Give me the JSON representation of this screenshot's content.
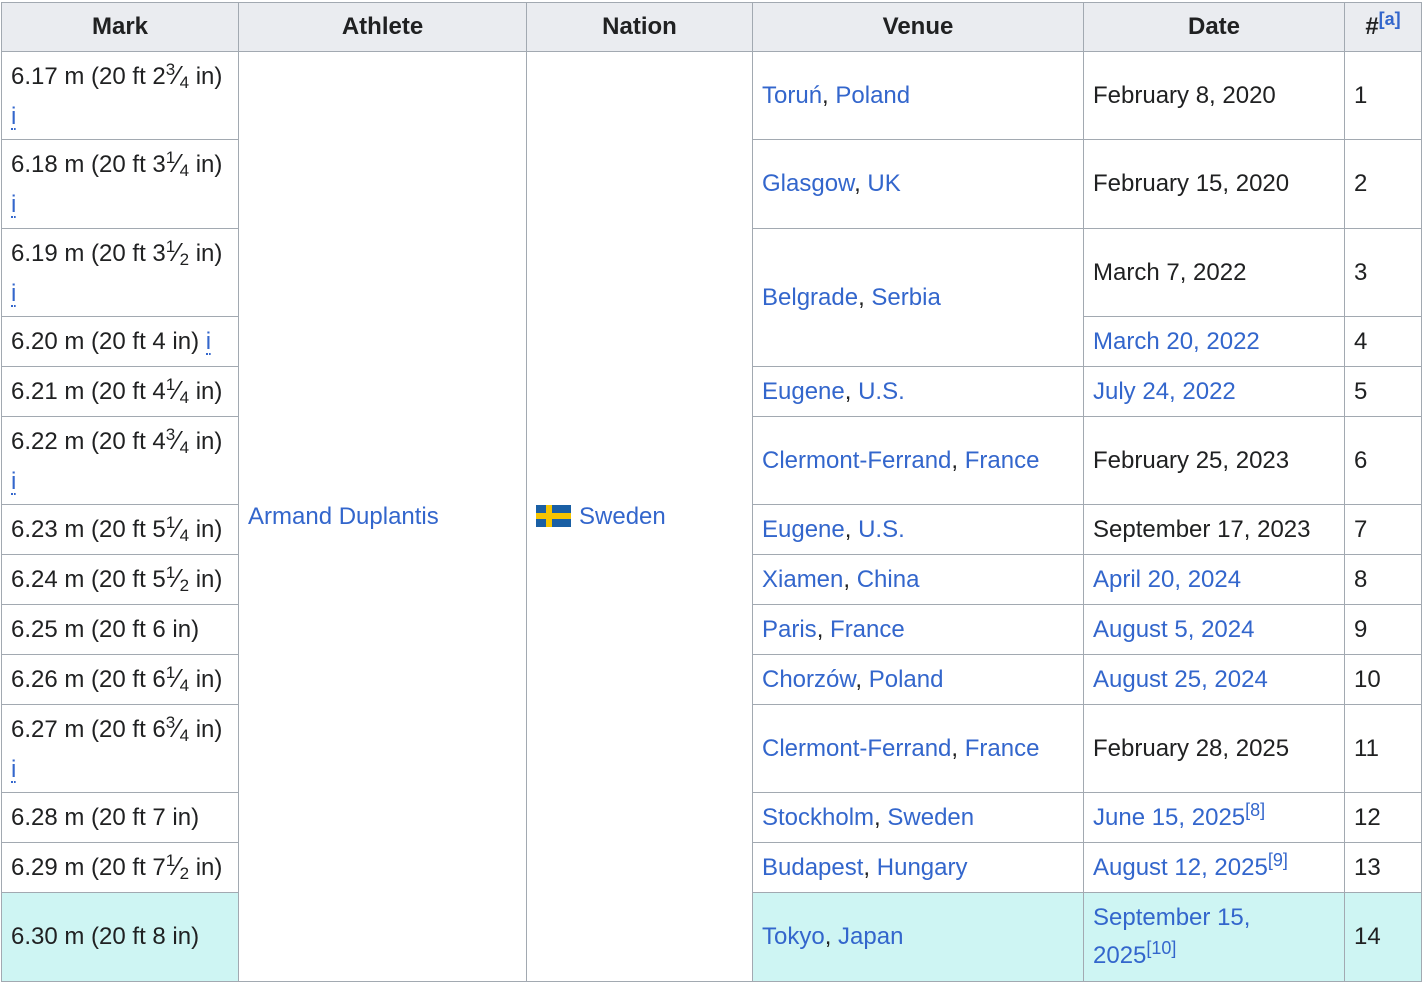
{
  "headers": {
    "mark": "Mark",
    "athlete": "Athlete",
    "nation": "Nation",
    "venue": "Venue",
    "date": "Date",
    "num": "#",
    "num_ref": "[a]"
  },
  "athlete": "Armand Duplantis",
  "nation": "Sweden",
  "info_link": "i",
  "rows": [
    {
      "mark_main": "6.17 m (20 ft 2",
      "frac_n": "3",
      "frac_d": "4",
      "mark_tail": " in)",
      "info": true,
      "city": "Toruń",
      "country": "Poland",
      "date": "February 8, 2020",
      "date_link": false,
      "date_ref": "",
      "num": "1"
    },
    {
      "mark_main": "6.18 m (20 ft 3",
      "frac_n": "1",
      "frac_d": "4",
      "mark_tail": " in)",
      "info": true,
      "city": "Glasgow",
      "country": "UK",
      "date": "February 15, 2020",
      "date_link": false,
      "date_ref": "",
      "num": "2"
    },
    {
      "mark_main": "6.19 m (20 ft 3",
      "frac_n": "1",
      "frac_d": "2",
      "mark_tail": " in)",
      "info": true,
      "city": "Belgrade",
      "country": "Serbia",
      "date": "March 7, 2022",
      "date_link": false,
      "date_ref": "",
      "num": "3"
    },
    {
      "mark_main": "6.20 m (20 ft 4 in) ",
      "frac_n": "",
      "frac_d": "",
      "mark_tail": "",
      "info": true,
      "city": "",
      "country": "",
      "date": "March 20, 2022",
      "date_link": true,
      "date_ref": "",
      "num": "4"
    },
    {
      "mark_main": "6.21 m (20 ft 4",
      "frac_n": "1",
      "frac_d": "4",
      "mark_tail": " in)",
      "info": false,
      "city": "Eugene",
      "country": "U.S.",
      "date": "July 24, 2022",
      "date_link": true,
      "date_ref": "",
      "num": "5"
    },
    {
      "mark_main": "6.22 m (20 ft 4",
      "frac_n": "3",
      "frac_d": "4",
      "mark_tail": " in)",
      "info": true,
      "city": "Clermont-Ferrand",
      "country": "France",
      "date": "February 25, 2023",
      "date_link": false,
      "date_ref": "",
      "num": "6"
    },
    {
      "mark_main": "6.23 m (20 ft 5",
      "frac_n": "1",
      "frac_d": "4",
      "mark_tail": " in)",
      "info": false,
      "city": "Eugene",
      "country": "U.S.",
      "date": "September 17, 2023",
      "date_link": false,
      "date_ref": "",
      "num": "7"
    },
    {
      "mark_main": "6.24 m (20 ft 5",
      "frac_n": "1",
      "frac_d": "2",
      "mark_tail": " in)",
      "info": false,
      "city": "Xiamen",
      "country": "China",
      "date": "April 20, 2024",
      "date_link": true,
      "date_ref": "",
      "num": "8"
    },
    {
      "mark_main": "6.25 m (20 ft 6 in)",
      "frac_n": "",
      "frac_d": "",
      "mark_tail": "",
      "info": false,
      "city": "Paris",
      "country": "France",
      "date": "August 5, 2024",
      "date_link": true,
      "date_ref": "",
      "num": "9"
    },
    {
      "mark_main": "6.26 m (20 ft 6",
      "frac_n": "1",
      "frac_d": "4",
      "mark_tail": " in)",
      "info": false,
      "city": "Chorzów",
      "country": "Poland",
      "date": "August 25, 2024",
      "date_link": true,
      "date_ref": "",
      "num": "10"
    },
    {
      "mark_main": "6.27 m (20 ft 6",
      "frac_n": "3",
      "frac_d": "4",
      "mark_tail": " in)",
      "info": true,
      "city": "Clermont-Ferrand",
      "country": "France",
      "date": "February 28, 2025",
      "date_link": false,
      "date_ref": "",
      "num": "11"
    },
    {
      "mark_main": "6.28 m (20 ft 7 in)",
      "frac_n": "",
      "frac_d": "",
      "mark_tail": "",
      "info": false,
      "city": "Stockholm",
      "country": "Sweden",
      "date": "June 15, 2025",
      "date_link": true,
      "date_ref": "[8]",
      "num": "12"
    },
    {
      "mark_main": "6.29 m (20 ft 7",
      "frac_n": "1",
      "frac_d": "2",
      "mark_tail": " in)",
      "info": false,
      "city": "Budapest",
      "country": "Hungary",
      "date": "August 12, 2025",
      "date_link": true,
      "date_ref": "[9]",
      "num": "13"
    },
    {
      "mark_main": "6.30 m (20 ft 8 in)",
      "frac_n": "",
      "frac_d": "",
      "mark_tail": "",
      "info": false,
      "city": "Tokyo",
      "country": "Japan",
      "date": "September 15, 2025",
      "date_link": true,
      "date_ref": "[10]",
      "num": "14"
    }
  ]
}
